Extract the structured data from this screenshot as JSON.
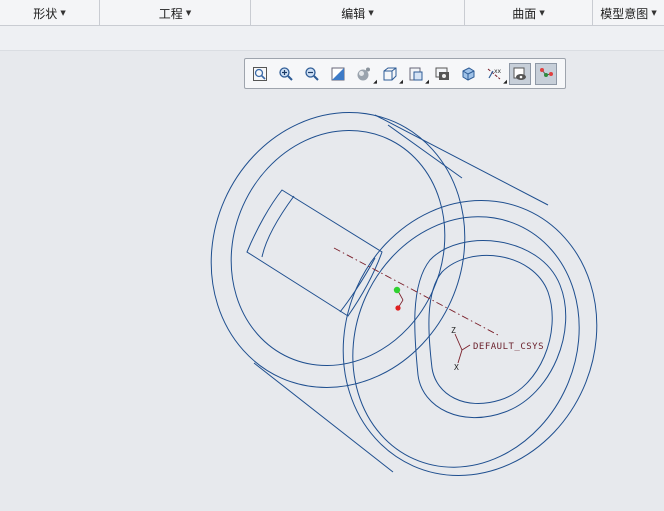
{
  "ribbon": {
    "groups": [
      {
        "label": "形状"
      },
      {
        "label": "工程"
      },
      {
        "label": "编辑"
      },
      {
        "label": "曲面"
      },
      {
        "label": "模型意图"
      }
    ]
  },
  "graphics_toolbar": {
    "buttons": [
      {
        "icon": "refit-icon"
      },
      {
        "icon": "zoom-in-icon"
      },
      {
        "icon": "zoom-out-icon"
      },
      {
        "icon": "repaint-icon"
      },
      {
        "icon": "display-style-icon"
      },
      {
        "icon": "saved-orientations-icon"
      },
      {
        "icon": "view-manager-icon"
      },
      {
        "icon": "perspective-view-icon"
      },
      {
        "icon": "section-view-icon"
      },
      {
        "icon": "datum-display-filters-icon"
      },
      {
        "icon": "annotation-display-icon"
      },
      {
        "icon": "spin-center-icon"
      }
    ]
  },
  "model": {
    "csys_label": "DEFAULT_CSYS",
    "axis_x_label": "X",
    "axis_z_label": "Z",
    "edge_color": "#1f4f8f",
    "datum_color": "#7a1f2a",
    "point_green": "#2fd12f",
    "point_red": "#e02020"
  }
}
